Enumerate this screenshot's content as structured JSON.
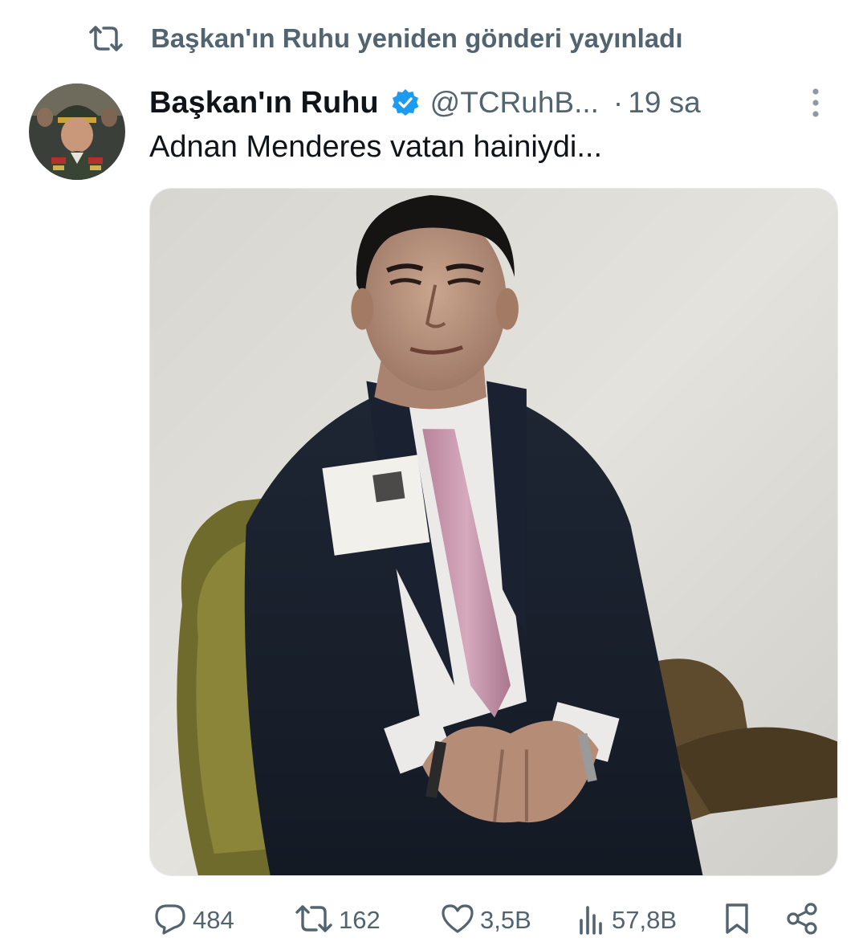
{
  "repost_banner": {
    "text": "Başkan'ın Ruhu yeniden gönderi yayınladı",
    "icon": "repost-icon"
  },
  "post": {
    "author": {
      "display_name": "Başkan'ın Ruhu",
      "verified": true,
      "handle": "@TCRuhB...",
      "avatar_icon": "avatar"
    },
    "separator": "·",
    "time": "19 sa",
    "text": "Adnan Menderes vatan hainiydi...",
    "media": {
      "kind": "photo"
    }
  },
  "actions": {
    "replies": "484",
    "reposts": "162",
    "likes": "3,5B",
    "views": "57,8B"
  },
  "colors": {
    "primary_text": "#0f1419",
    "secondary_text": "#536471",
    "verified_badge": "#1d9bf0",
    "background": "#ffffff"
  }
}
